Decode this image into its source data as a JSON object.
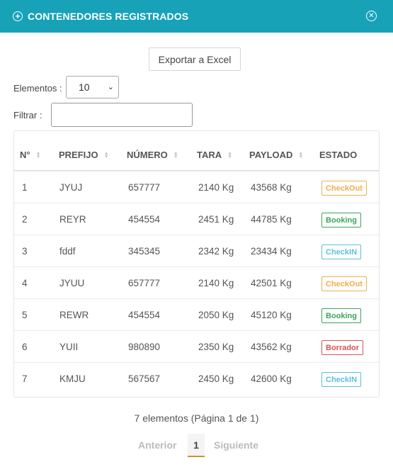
{
  "header": {
    "title": "CONTENEDORES REGISTRADOS"
  },
  "toolbar": {
    "export_label": "Exportar a Excel",
    "elements_label": "Elementos :",
    "elements_value": "10",
    "filter_label": "Filtrar :",
    "filter_value": ""
  },
  "table": {
    "columns": [
      "N°",
      "PREFIJO",
      "NÚMERO",
      "TARA",
      "PAYLOAD",
      "ESTADO"
    ],
    "rows": [
      {
        "n": "1",
        "prefijo": "JYUJ",
        "numero": "657777",
        "tara": "2140 Kg",
        "payload": "43568 Kg",
        "estado": "CheckOut"
      },
      {
        "n": "2",
        "prefijo": "REYR",
        "numero": "454554",
        "tara": "2451 Kg",
        "payload": "44785 Kg",
        "estado": "Booking"
      },
      {
        "n": "3",
        "prefijo": "fddf",
        "numero": "345345",
        "tara": "2342 Kg",
        "payload": "23434 Kg",
        "estado": "CheckIN"
      },
      {
        "n": "4",
        "prefijo": "JYUU",
        "numero": "657777",
        "tara": "2140 Kg",
        "payload": "42501 Kg",
        "estado": "CheckOut"
      },
      {
        "n": "5",
        "prefijo": "REWR",
        "numero": "454554",
        "tara": "2050 Kg",
        "payload": "45120 Kg",
        "estado": "Booking"
      },
      {
        "n": "6",
        "prefijo": "YUII",
        "numero": "980890",
        "tara": "2350 Kg",
        "payload": "43562 Kg",
        "estado": "Borrador"
      },
      {
        "n": "7",
        "prefijo": "KMJU",
        "numero": "567567",
        "tara": "2450 Kg",
        "payload": "42600 Kg",
        "estado": "CheckIN"
      }
    ]
  },
  "status_colors": {
    "CheckOut": "#f0ad4e",
    "Booking": "#3da35d",
    "CheckIN": "#5bc0de",
    "Borrador": "#d9534f"
  },
  "footer": {
    "info": "7 elementos (Página 1 de 1)",
    "prev": "Anterior",
    "page": "1",
    "next": "Siguiente"
  },
  "colors": {
    "header_bg": "#17a2b8",
    "pagination_accent": "#c9942b"
  }
}
